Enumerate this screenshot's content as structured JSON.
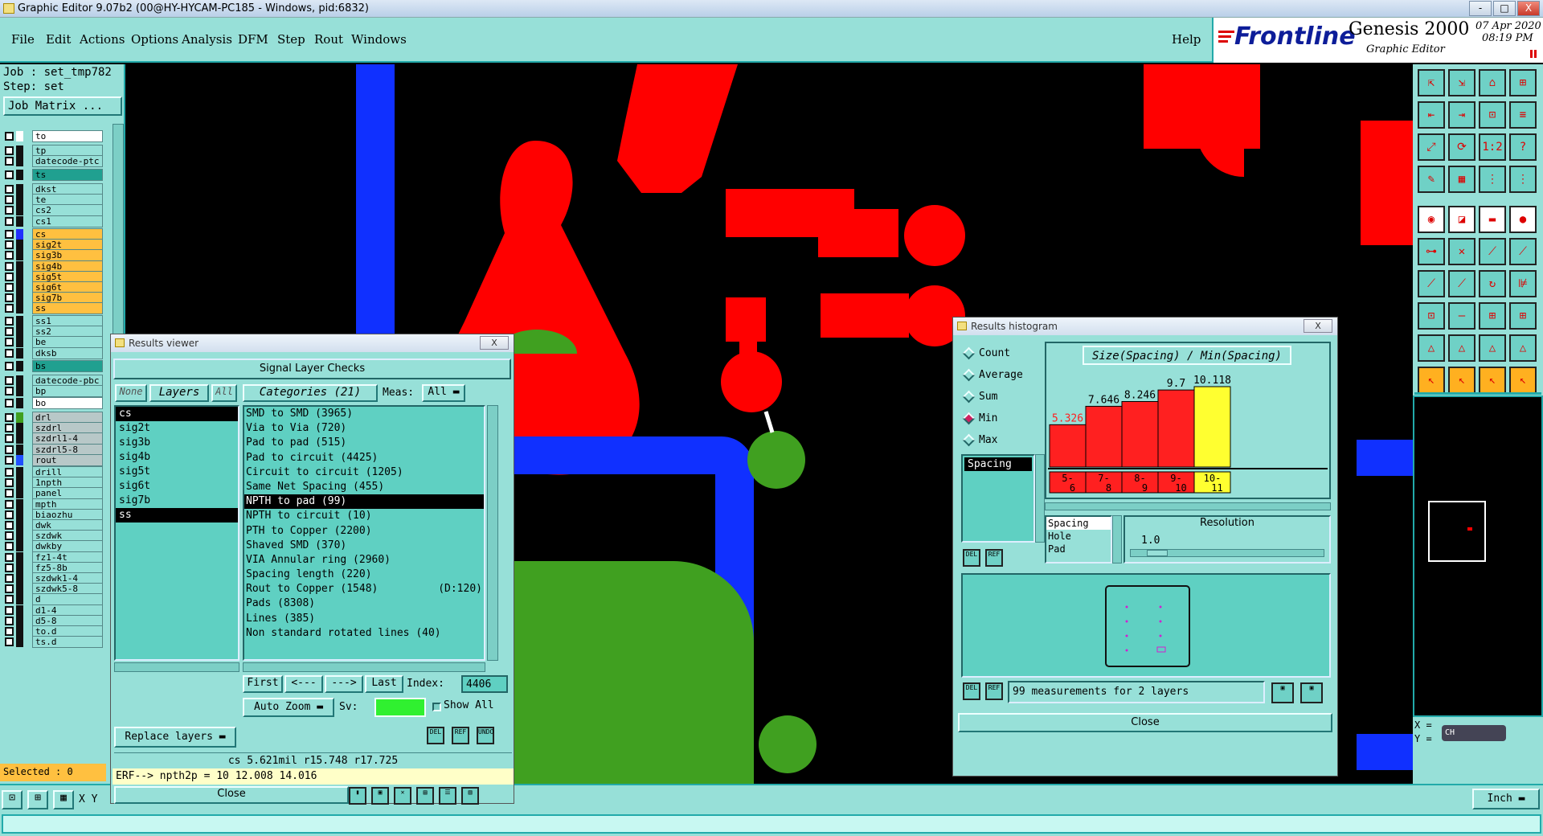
{
  "window": {
    "title": "Graphic Editor 9.07b2 (00@HY-HYCAM-PC185 - Windows, pid:6832)",
    "minimize": "-",
    "maximize": "□",
    "close": "X"
  },
  "menu": {
    "file": "File",
    "edit": "Edit",
    "actions": "Actions",
    "options": "Options",
    "analysis": "Analysis",
    "dfm": "DFM",
    "step": "Step",
    "rout": "Rout",
    "windows": "Windows",
    "help": "Help"
  },
  "brand": {
    "logo": "Frontline",
    "product": "Genesis 2000",
    "subtitle": "Graphic Editor",
    "date": "07 Apr 2020",
    "time": "08:19 PM"
  },
  "job": {
    "job_line": "Job : set_tmp782",
    "step_line": "Step: set",
    "matrix_button": "Job Matrix ..."
  },
  "layers": [
    {
      "name": "to",
      "color": "#ffffff",
      "bg": "#ffffff"
    },
    {
      "name": "tp",
      "color": "#111111",
      "bg": "#97e0d8"
    },
    {
      "name": "datecode-ptc",
      "color": "#111111",
      "bg": "#97e0d8"
    },
    {
      "name": "ts",
      "color": "#111111",
      "bg": "#20a090"
    },
    {
      "name": "dkst",
      "color": "#111111",
      "bg": "#97e0d8"
    },
    {
      "name": "te",
      "color": "#111111",
      "bg": "#97e0d8"
    },
    {
      "name": "cs2",
      "color": "#111111",
      "bg": "#97e0d8"
    },
    {
      "name": "cs1",
      "color": "#111111",
      "bg": "#97e0d8"
    },
    {
      "name": "cs",
      "color": "#2030ff",
      "bg": "#ffc040"
    },
    {
      "name": "sig2t",
      "color": "#111111",
      "bg": "#ffc040"
    },
    {
      "name": "sig3b",
      "color": "#111111",
      "bg": "#ffc040"
    },
    {
      "name": "sig4b",
      "color": "#111111",
      "bg": "#ffc040"
    },
    {
      "name": "sig5t",
      "color": "#111111",
      "bg": "#ffc040"
    },
    {
      "name": "sig6t",
      "color": "#111111",
      "bg": "#ffc040"
    },
    {
      "name": "sig7b",
      "color": "#111111",
      "bg": "#ffc040"
    },
    {
      "name": "ss",
      "color": "#111111",
      "bg": "#ffc040"
    },
    {
      "name": "ss1",
      "color": "#111111",
      "bg": "#97e0d8"
    },
    {
      "name": "ss2",
      "color": "#111111",
      "bg": "#97e0d8"
    },
    {
      "name": "be",
      "color": "#111111",
      "bg": "#97e0d8"
    },
    {
      "name": "dksb",
      "color": "#111111",
      "bg": "#97e0d8"
    },
    {
      "name": "bs",
      "color": "#111111",
      "bg": "#20a090"
    },
    {
      "name": "datecode-pbc",
      "color": "#111111",
      "bg": "#97e0d8"
    },
    {
      "name": "bp",
      "color": "#111111",
      "bg": "#97e0d8"
    },
    {
      "name": "bo",
      "color": "#111111",
      "bg": "#ffffff"
    },
    {
      "name": "drl",
      "color": "#40a020",
      "bg": "#b8c8c8"
    },
    {
      "name": "szdrl",
      "color": "#111111",
      "bg": "#b8c8c8"
    },
    {
      "name": "szdrl1-4",
      "color": "#111111",
      "bg": "#b8c8c8"
    },
    {
      "name": "szdrl5-8",
      "color": "#111111",
      "bg": "#b8c8c8"
    },
    {
      "name": "rout",
      "color": "#2050ff",
      "bg": "#b8c8c8"
    },
    {
      "name": "drill",
      "color": "#111111",
      "bg": "#97e0d8"
    },
    {
      "name": "1npth",
      "color": "#111111",
      "bg": "#97e0d8"
    },
    {
      "name": "panel",
      "color": "#111111",
      "bg": "#97e0d8"
    },
    {
      "name": "mpth",
      "color": "#111111",
      "bg": "#97e0d8"
    },
    {
      "name": "biaozhu",
      "color": "#111111",
      "bg": "#97e0d8"
    },
    {
      "name": "dwk",
      "color": "#111111",
      "bg": "#97e0d8"
    },
    {
      "name": "szdwk",
      "color": "#111111",
      "bg": "#97e0d8"
    },
    {
      "name": "dwkby",
      "color": "#111111",
      "bg": "#97e0d8"
    },
    {
      "name": "fz1-4t",
      "color": "#111111",
      "bg": "#97e0d8"
    },
    {
      "name": "fz5-8b",
      "color": "#111111",
      "bg": "#97e0d8"
    },
    {
      "name": "szdwk1-4",
      "color": "#111111",
      "bg": "#97e0d8"
    },
    {
      "name": "szdwk5-8",
      "color": "#111111",
      "bg": "#97e0d8"
    },
    {
      "name": "d",
      "color": "#111111",
      "bg": "#97e0d8"
    },
    {
      "name": "d1-4",
      "color": "#111111",
      "bg": "#97e0d8"
    },
    {
      "name": "d5-8",
      "color": "#111111",
      "bg": "#97e0d8"
    },
    {
      "name": "to.d",
      "color": "#111111",
      "bg": "#97e0d8"
    },
    {
      "name": "ts.d",
      "color": "#111111",
      "bg": "#97e0d8"
    }
  ],
  "selected": "Selected : 0",
  "results_viewer": {
    "title": "Results viewer",
    "close_x": "X",
    "header": "Signal Layer Checks",
    "none_btn": "None",
    "layers_btn": "Layers",
    "all_btn": "All",
    "categories_btn": "Categories (21)",
    "meas_label": "Meas:",
    "meas_value": "All",
    "layer_list": [
      "cs",
      "sig2t",
      "sig3b",
      "sig4b",
      "sig5t",
      "sig6t",
      "sig7b",
      "ss"
    ],
    "categories": [
      "SMD to SMD (3965)",
      "Via to Via (720)",
      "Pad to pad (515)",
      "Pad to circuit (4425)",
      "Circuit to circuit (1205)",
      "Same Net Spacing (455)",
      "NPTH to pad (99)",
      "NPTH to circuit (10)",
      "PTH to Copper (2200)",
      "Shaved SMD (370)",
      "VIA Annular ring (2960)",
      "Spacing length (220)",
      "Rout to Copper (1548)",
      "Pads (8308)",
      "Lines (385)",
      "Non standard rotated lines (40)"
    ],
    "rout_extra": "(D:120)",
    "first": "First",
    "prev": "<---",
    "next": "--->",
    "last": "Last",
    "index_label": "Index:",
    "index_value": "4406",
    "auto_zoom": "Auto Zoom",
    "sv_label": "Sv:",
    "show_all": "Show All",
    "replace_layers": "Replace layers",
    "del": "DEL",
    "ref": "REF",
    "undo": "UNDO",
    "measure_line": "cs 5.621mil  r15.748  r17.725",
    "erf_line": "ERF--> npth2p = 10 12.008 14.016",
    "close": "Close"
  },
  "histogram": {
    "title": "Results histogram",
    "close_x": "X",
    "modes": [
      "Count",
      "Average",
      "Sum",
      "Min",
      "Max"
    ],
    "selected_mode": "Min",
    "metric_list": [
      "Spacing"
    ],
    "resolution_list": [
      "Spacing",
      "Hole",
      "Pad"
    ],
    "resolution_label": "Resolution",
    "resolution_value": "1.0",
    "summary": "99 measurements for 2 layers",
    "del": "DEL",
    "ref": "REF",
    "close": "Close"
  },
  "chart_data": {
    "type": "bar",
    "title": "Size(Spacing) / Min(Spacing)",
    "categories": [
      "5-6",
      "7-8",
      "8-9",
      "9-10",
      "10-11"
    ],
    "values": [
      5.326,
      7.646,
      8.246,
      9.7,
      10.118
    ],
    "labels": [
      "5.326",
      "7.646",
      "8.246",
      "9.7",
      "10.118"
    ],
    "colors": [
      "#ff2020",
      "#ff2020",
      "#ff2020",
      "#ff2020",
      "#ffff30"
    ],
    "cat_top": [
      "5-",
      "7-",
      "8-",
      "9-",
      "10-"
    ],
    "cat_bottom": [
      "6",
      "8",
      "9",
      "10",
      "11"
    ],
    "ylim": [
      0,
      10.118
    ]
  },
  "status": {
    "xy": "X Y",
    "units": "Inch",
    "coord_x": "X =",
    "coord_y": "Y =",
    "ch": "CH"
  },
  "colors": {
    "panel": "#97e0d8",
    "dark_teal": "#20a090",
    "red": "#ff0000",
    "blue": "#1030ff",
    "green": "#40a020"
  }
}
